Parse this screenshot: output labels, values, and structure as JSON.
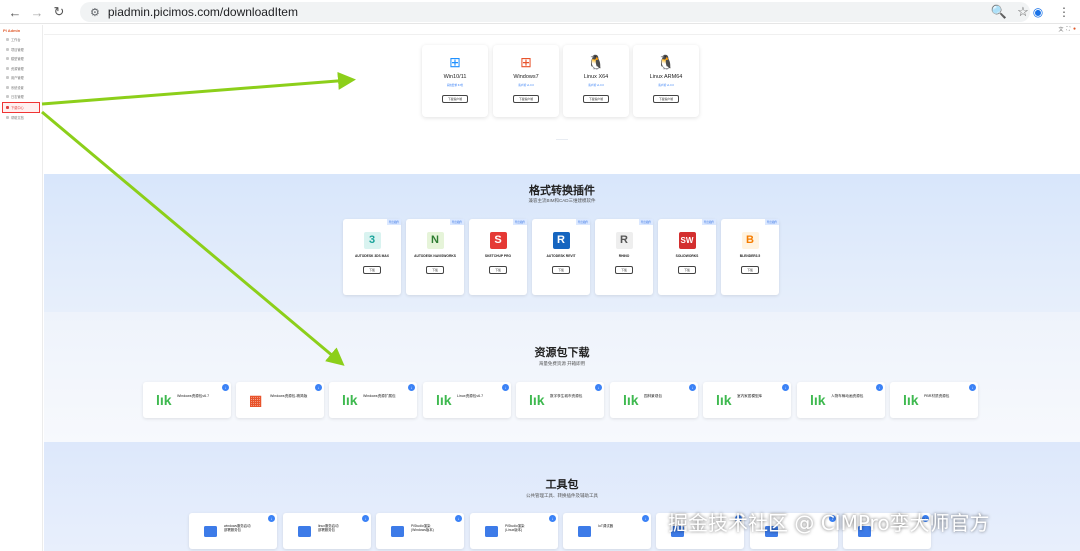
{
  "browser": {
    "url": "piadmin.picimos.com/downloadItem"
  },
  "sidebar": {
    "logo": "PI Admin",
    "items": [
      {
        "label": "工作台"
      },
      {
        "label": "项目管理"
      },
      {
        "label": "模型管理"
      },
      {
        "label": "资源管理"
      },
      {
        "label": "用户管理"
      },
      {
        "label": "系统设置"
      },
      {
        "label": "日志管理"
      },
      {
        "label": "下载中心"
      },
      {
        "label": "帮助文档"
      }
    ]
  },
  "client_downloads": [
    {
      "name": "Win10/11",
      "sub": "系统要求 64位",
      "btn": "下载客户端",
      "icon": "windows-icon"
    },
    {
      "name": "Windows7",
      "sub": "客户端 v1.0.0",
      "btn": "下载客户端",
      "icon": "windows7-icon"
    },
    {
      "name": "Linux X64",
      "sub": "客户端 v1.0.0",
      "btn": "下载客户端",
      "icon": "linux-icon"
    },
    {
      "name": "Linux ARM64",
      "sub": "客户端 v1.0.0",
      "btn": "下载客户端",
      "icon": "linux-icon"
    }
  ],
  "plugins_section": {
    "title": "格式转换插件",
    "subtitle": "兼容主流BIM和CAD三维建模软件",
    "tag": "导出插件",
    "btn": "下载",
    "items": [
      {
        "name": "AUTODESK 3DS MAX",
        "logo": "3"
      },
      {
        "name": "AUTODESK NAVISWORKS",
        "logo": "N"
      },
      {
        "name": "SKETCHUP PRO",
        "logo": "S"
      },
      {
        "name": "AUTODESK REVIT",
        "logo": "R"
      },
      {
        "name": "RHINO",
        "logo": "R"
      },
      {
        "name": "SOLIDWORKS",
        "logo": "SW"
      },
      {
        "name": "BLENDER3.5",
        "logo": "B"
      }
    ]
  },
  "resources_section": {
    "title": "资源包下载",
    "subtitle": "海量免费资源 开箱即用",
    "items": [
      {
        "name": "Windows资源包v6.7"
      },
      {
        "name": "Windows资源包-精简版"
      },
      {
        "name": "Windows资源扩展包"
      },
      {
        "name": "Linux资源包v6.7"
      },
      {
        "name": "数字孪生城市资源包"
      },
      {
        "name": "园林景观包"
      },
      {
        "name": "室内家居模型库"
      },
      {
        "name": "人物车辆动画资源包"
      },
      {
        "name": "PBR材质资源包"
      }
    ]
  },
  "tools_section": {
    "title": "工具包",
    "subtitle": "公共管理工具、转换插件及辅助工具",
    "items": [
      {
        "name": "windows服务启动",
        "name2": "部署服务包"
      },
      {
        "name": "linux服务启动",
        "name2": "部署服务包"
      },
      {
        "name": "PiStudio渲染",
        "name2": "(Windows版本)"
      },
      {
        "name": "PiStudio渲染",
        "name2": "(Linux版本)"
      },
      {
        "name": "IoT调试器",
        "name2": ""
      }
    ]
  },
  "watermark": "掘金技术社区 @ CIMPro孪大师官方"
}
